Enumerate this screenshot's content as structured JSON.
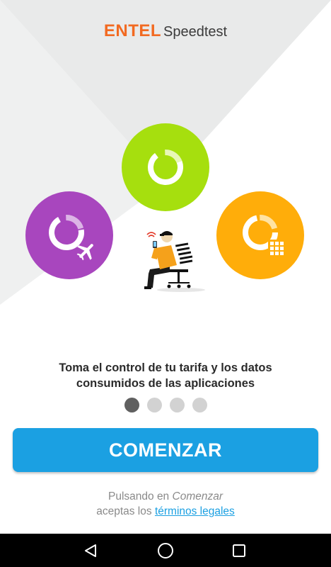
{
  "colors": {
    "brand_orange": "#f26a21",
    "green_circle": "#a6df0e",
    "purple_circle": "#a846be",
    "orange_circle": "#ffad0a",
    "button_blue": "#1ba0e2",
    "dot_active": "#606060",
    "dot_inactive": "#d2d2d2"
  },
  "header": {
    "brand": "ENTEL",
    "product": "Speedtest"
  },
  "feature_icons": [
    {
      "name": "speed-gauge-icon",
      "color": "green"
    },
    {
      "name": "roaming-airplane-icon",
      "color": "purple"
    },
    {
      "name": "apps-data-icon",
      "color": "orange"
    }
  ],
  "illustration": "person-on-bench-with-phone",
  "main": {
    "tagline_line1": "Toma el control de tu tarifa y los datos",
    "tagline_line2": "consumidos de las aplicaciones"
  },
  "pager": {
    "total": 4,
    "active_index": 0
  },
  "start_button": {
    "label": "COMENZAR"
  },
  "legal": {
    "prefix": "Pulsando en",
    "emphasis": "Comenzar",
    "line2_prefix": "aceptas los",
    "link": "términos legales"
  },
  "navbar": {
    "back": "back-icon",
    "home": "home-icon",
    "recent": "recent-apps-icon"
  }
}
